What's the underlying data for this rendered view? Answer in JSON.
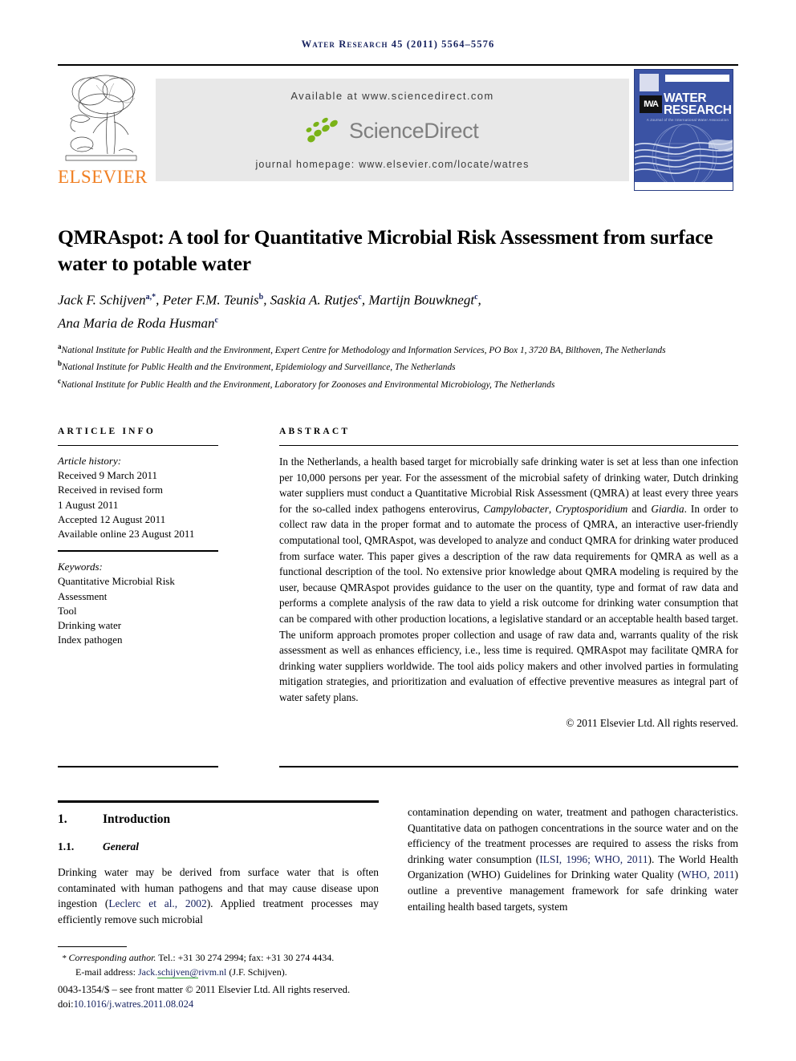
{
  "running_head": {
    "journal": "Water Research",
    "volume_info": "45 (2011) 5564–5576"
  },
  "masthead": {
    "publisher_logo_text": "ELSEVIER",
    "available_at": "Available at www.sciencedirect.com",
    "sciencedirect_wordmark": "ScienceDirect",
    "journal_homepage": "journal homepage: www.elsevier.com/locate/watres",
    "cover": {
      "line1": "WATER",
      "line2": "RESEARCH",
      "society_mark": "IWA",
      "tagline": "A Journal of the International Water Association"
    }
  },
  "article": {
    "title": "QMRAspot: A tool for Quantitative Microbial Risk Assessment from surface water to potable water",
    "authors_line1_parts": [
      {
        "name": "Jack F. Schijven",
        "sup": "a,*",
        "sep": ", "
      },
      {
        "name": "Peter F.M. Teunis",
        "sup": "b",
        "sep": ", "
      },
      {
        "name": "Saskia A. Rutjes",
        "sup": "c",
        "sep": ", "
      },
      {
        "name": "Martijn Bouwknegt",
        "sup": "c",
        "sep": ","
      }
    ],
    "authors_line2_parts": [
      {
        "name": "Ana Maria de Roda Husman",
        "sup": "c",
        "sep": ""
      }
    ],
    "affiliations": [
      {
        "marker": "a",
        "text": "National Institute for Public Health and the Environment, Expert Centre for Methodology and Information Services, PO Box 1, 3720 BA, Bilthoven, The Netherlands"
      },
      {
        "marker": "b",
        "text": "National Institute for Public Health and the Environment, Epidemiology and Surveillance, The Netherlands"
      },
      {
        "marker": "c",
        "text": "National Institute for Public Health and the Environment, Laboratory for Zoonoses and Environmental Microbiology, The Netherlands"
      }
    ]
  },
  "article_info": {
    "heading": "ARTICLE INFO",
    "history_label": "Article history:",
    "history": [
      "Received 9 March 2011",
      "Received in revised form",
      "1 August 2011",
      "Accepted 12 August 2011",
      "Available online 23 August 2011"
    ],
    "keywords_label": "Keywords:",
    "keywords": [
      "Quantitative Microbial Risk",
      "Assessment",
      "Tool",
      "Drinking water",
      "Index pathogen"
    ]
  },
  "abstract": {
    "heading": "ABSTRACT",
    "paragraph_1": "In the Netherlands, a health based target for microbially safe drinking water is set at less than one infection per 10,000 persons per year. For the assessment of the microbial safety of drinking water, Dutch drinking water suppliers must conduct a Quantitative Microbial Risk Assessment (QMRA) at least every three years for the so-called index pathogens enterovirus, ",
    "italic_1": "Campylobacter",
    "paragraph_1b": ", ",
    "italic_2": "Cryptosporidium",
    "paragraph_1c": " and ",
    "italic_3": "Giardia",
    "paragraph_1d": ". In order to collect raw data in the proper format and to automate the process of QMRA, an interactive user-friendly computational tool, QMRAspot, was developed to analyze and conduct QMRA for drinking water produced from surface water. This paper gives a description of the raw data requirements for QMRA as well as a functional description of the tool. No extensive prior knowledge about QMRA modeling is required by the user, because QMRAspot provides guidance to the user on the quantity, type and format of raw data and performs a complete analysis of the raw data to yield a risk outcome for drinking water consumption that can be compared with other production locations, a legislative standard or an acceptable health based target. The uniform approach promotes proper collection and usage of raw data and, warrants quality of the risk assessment as well as enhances efficiency, i.e., less time is required. QMRAspot may facilitate QMRA for drinking water suppliers worldwide. The tool aids policy makers and other involved parties in formulating mitigation strategies, and prioritization and evaluation of effective preventive measures as integral part of water safety plans.",
    "copyright": "© 2011 Elsevier Ltd. All rights reserved."
  },
  "body": {
    "section_number": "1.",
    "section_title": "Introduction",
    "subsection_number": "1.1.",
    "subsection_title": "General",
    "left_paragraph_pre": "Drinking water may be derived from surface water that is often contaminated with human pathogens and that may cause disease upon ingestion (",
    "left_cite_1": "Leclerc et al., 2002",
    "left_paragraph_post": "). Applied treatment processes may efficiently remove such microbial",
    "right_paragraph_pre": "contamination depending on water, treatment and pathogen characteristics. Quantitative data on pathogen concentrations in the source water and on the efficiency of the treatment processes are required to assess the risks from drinking water consumption (",
    "right_cite_1": "ILSI, 1996; WHO, 2011",
    "right_paragraph_mid": "). The World Health Organization (WHO) Guidelines for Drinking water Quality (",
    "right_cite_2": "WHO, 2011",
    "right_paragraph_post": ") outline a preventive management framework for safe drinking water entailing health based targets, system"
  },
  "footer": {
    "corresponding_star": "*",
    "corresponding_label": "Corresponding author.",
    "corresponding_contact": " Tel.: +31 30 274 2994; fax: +31 30 274 4434.",
    "email_label": "E-mail address: ",
    "email_part_1": "Jack.",
    "email_part_2": "schijven@",
    "email_part_3": "rivm.nl",
    "email_owner": " (J.F. Schijven).",
    "issn_line": "0043-1354/$ – see front matter © 2011 Elsevier Ltd. All rights reserved.",
    "doi_prefix": "doi:",
    "doi_value": "10.1016/j.watres.2011.08.024"
  },
  "colors": {
    "header_navy": "#15215e",
    "elsevier_orange": "#f07f22",
    "sciencedirect_gray": "#7f7f7f",
    "sciencedirect_green": "#7ab317",
    "cover_blue": "#3b53a4",
    "band_gray": "#e8e8e8",
    "link_green_underline": "#2aa02a"
  }
}
